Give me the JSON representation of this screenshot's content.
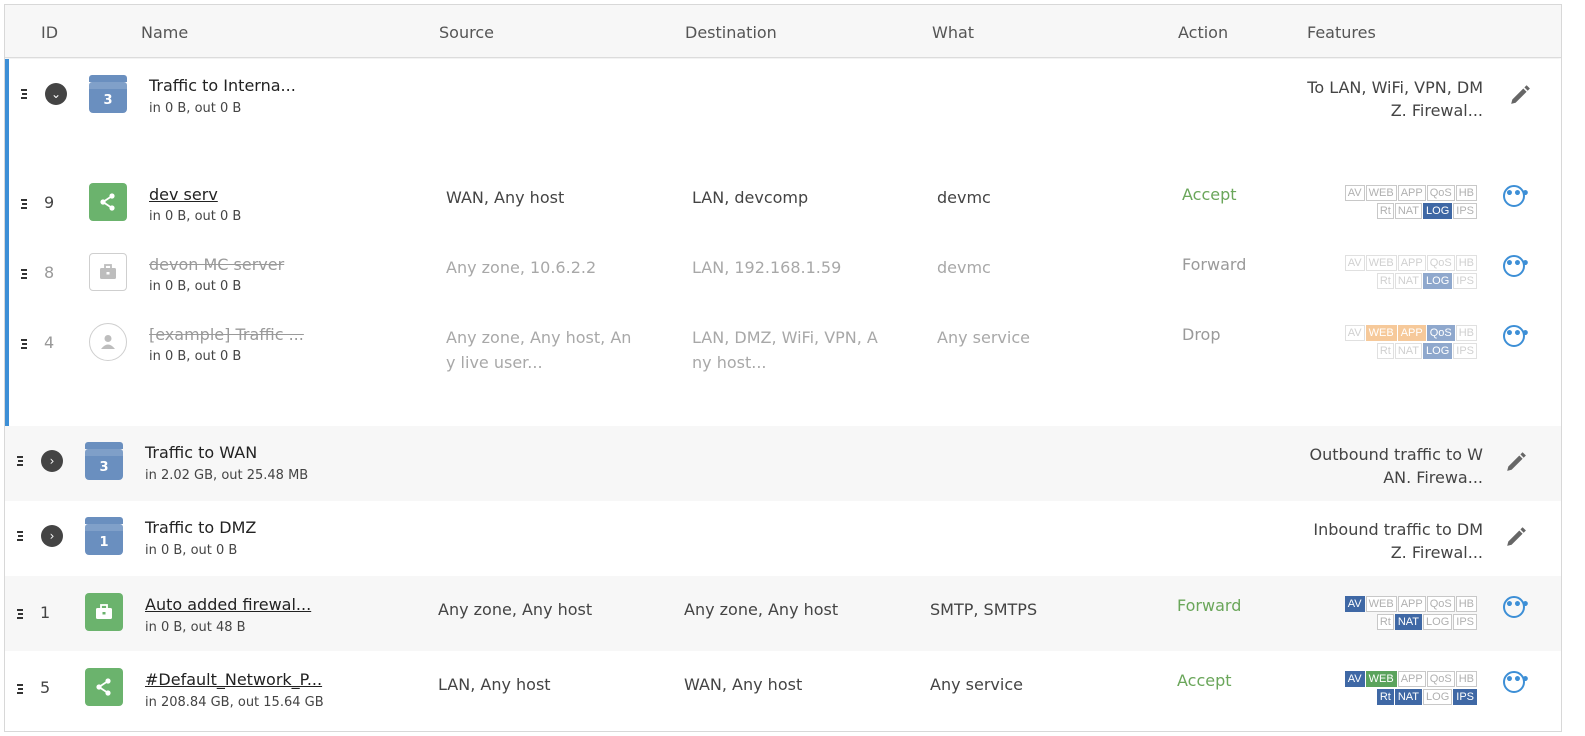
{
  "headers": {
    "id": "ID",
    "name": "Name",
    "source": "Source",
    "destination": "Destination",
    "what": "What",
    "action": "Action",
    "features": "Features"
  },
  "groups": {
    "internal": {
      "title": "Traffic to Interna...",
      "traffic": "in 0 B, out 0 B",
      "count": "3",
      "desc_l1": "To LAN, WiFi, VPN, DM",
      "desc_l2": "Z. Firewal..."
    },
    "wan": {
      "title": "Traffic to WAN",
      "traffic": "in 2.02 GB, out 25.48 MB",
      "count": "3",
      "desc_l1": "Outbound traffic to W",
      "desc_l2": "AN. Firewa..."
    },
    "dmz": {
      "title": "Traffic to DMZ",
      "traffic": "in 0 B, out 0 B",
      "count": "1",
      "desc_l1": "Inbound traffic to DM",
      "desc_l2": "Z. Firewal..."
    }
  },
  "rules": [
    {
      "id": "9",
      "name": "dev serv",
      "traffic": "in 0 B, out 0 B",
      "src_l1": "WAN, Any host",
      "src_l2": "",
      "dst_l1": "LAN, devcomp",
      "dst_l2": "",
      "what": "devmc",
      "action": "Accept"
    },
    {
      "id": "8",
      "name": "devon MC server",
      "traffic": "in 0 B, out 0 B",
      "src_l1": "Any zone, 10.6.2.2",
      "src_l2": "",
      "dst_l1": "LAN, 192.168.1.59",
      "dst_l2": "",
      "what": "devmc",
      "action": "Forward"
    },
    {
      "id": "4",
      "name": "[example] Traffic ...",
      "traffic": "in 0 B, out 0 B",
      "src_l1": "Any zone, Any host, An",
      "src_l2": "y live user...",
      "dst_l1": "LAN, DMZ, WiFi, VPN, A",
      "dst_l2": "ny host...",
      "what": "Any service",
      "action": "Drop"
    },
    {
      "id": "1",
      "name": "Auto added firewal...",
      "traffic": "in 0 B, out 48 B",
      "src_l1": "Any zone, Any host",
      "src_l2": "",
      "dst_l1": "Any zone, Any host",
      "dst_l2": "",
      "what": "SMTP, SMTPS",
      "action": "Forward"
    },
    {
      "id": "5",
      "name": "#Default_Network_P...",
      "traffic": "in 208.84 GB, out 15.64 GB",
      "src_l1": "LAN, Any host",
      "src_l2": "",
      "dst_l1": "WAN, Any host",
      "dst_l2": "",
      "what": "Any service",
      "action": "Accept"
    }
  ],
  "feature_tags": {
    "av": "AV",
    "web": "WEB",
    "app": "APP",
    "qos": "QoS",
    "hb": "HB",
    "rt": "Rt",
    "nat": "NAT",
    "log": "LOG",
    "ips": "IPS"
  },
  "colors": {
    "accent": "#3d8fd6",
    "accept": "#6aa65a",
    "group_icon": "#6a8fbf",
    "tag_on": "#3f68a5"
  }
}
